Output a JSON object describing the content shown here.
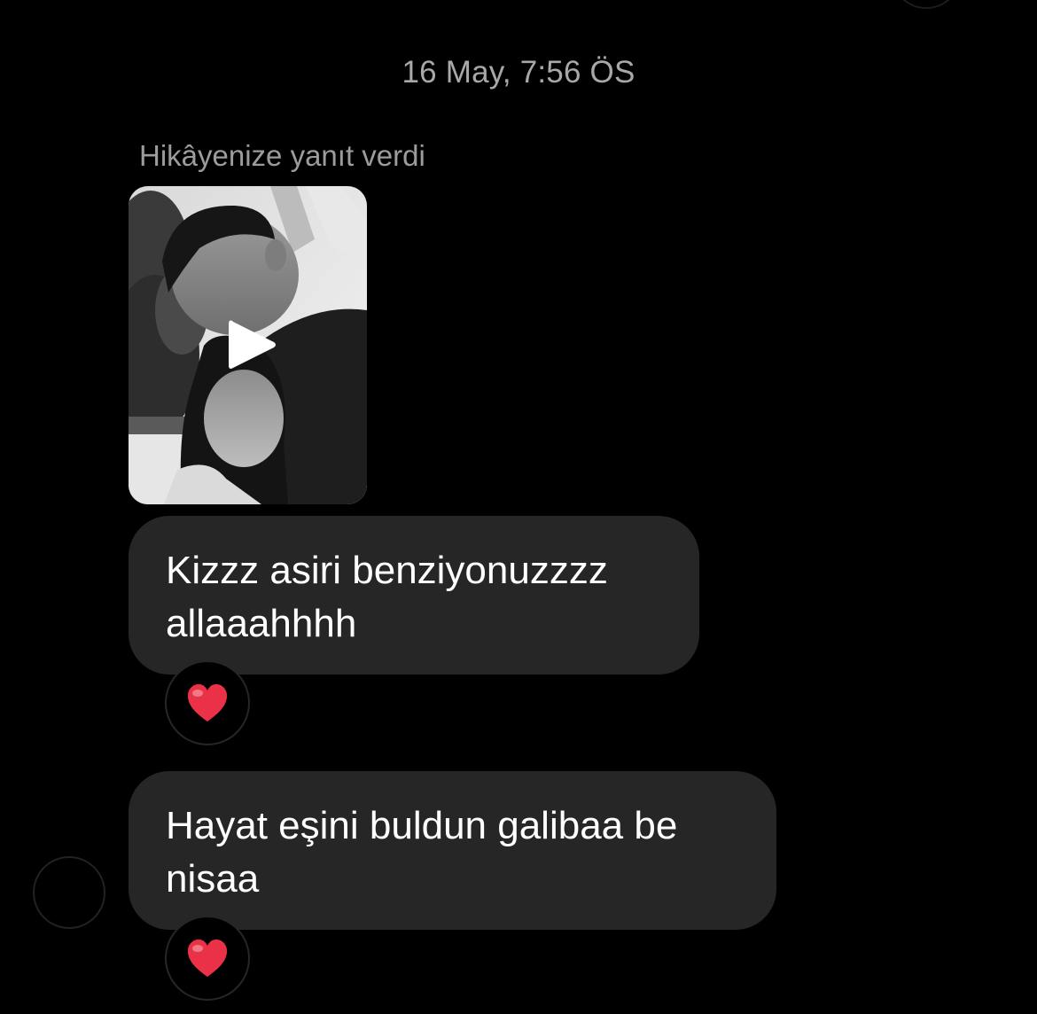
{
  "thread": {
    "timestamp": "16 May, 7:56 ÖS",
    "story_reply": {
      "caption": "Hikâyenize yanıt verdi",
      "media_type": "video",
      "play_icon": "play-icon"
    },
    "messages": [
      {
        "text": "Kizzz asiri benziyonuzzzz allaaahhhh",
        "reaction": "❤️",
        "reaction_icon": "red-heart-icon"
      },
      {
        "text": "Hayat eşini buldun galibaa be nisaa",
        "reaction": "❤️",
        "reaction_icon": "red-heart-icon"
      }
    ]
  },
  "colors": {
    "background": "#000000",
    "bubble": "#262626",
    "timestamp_text": "#a8a8a8",
    "caption_text": "#9c9c9c",
    "heart": "#e0245e"
  }
}
